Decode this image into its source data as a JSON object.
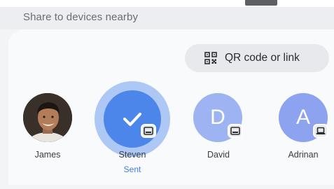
{
  "header": {
    "title": "Share to devices nearby"
  },
  "qr_chip": {
    "label": "QR code or link",
    "icon": "qr-code-icon"
  },
  "devices": [
    {
      "name": "James",
      "status": "",
      "avatar": "photo"
    },
    {
      "name": "Steven",
      "status": "Sent",
      "avatar": "check-icon",
      "badge": "tablet-icon"
    },
    {
      "name": "David",
      "status": "",
      "avatar_letter": "D",
      "badge": "tablet-icon"
    },
    {
      "name": "Adrinan",
      "status": "",
      "avatar_letter": "A",
      "badge": "laptop-icon"
    }
  ],
  "colors": {
    "accent": "#4d86ea",
    "sent_text": "#3f7fe6",
    "david_avatar": "#9db3f2",
    "adrinan_avatar": "#8da3f0"
  }
}
